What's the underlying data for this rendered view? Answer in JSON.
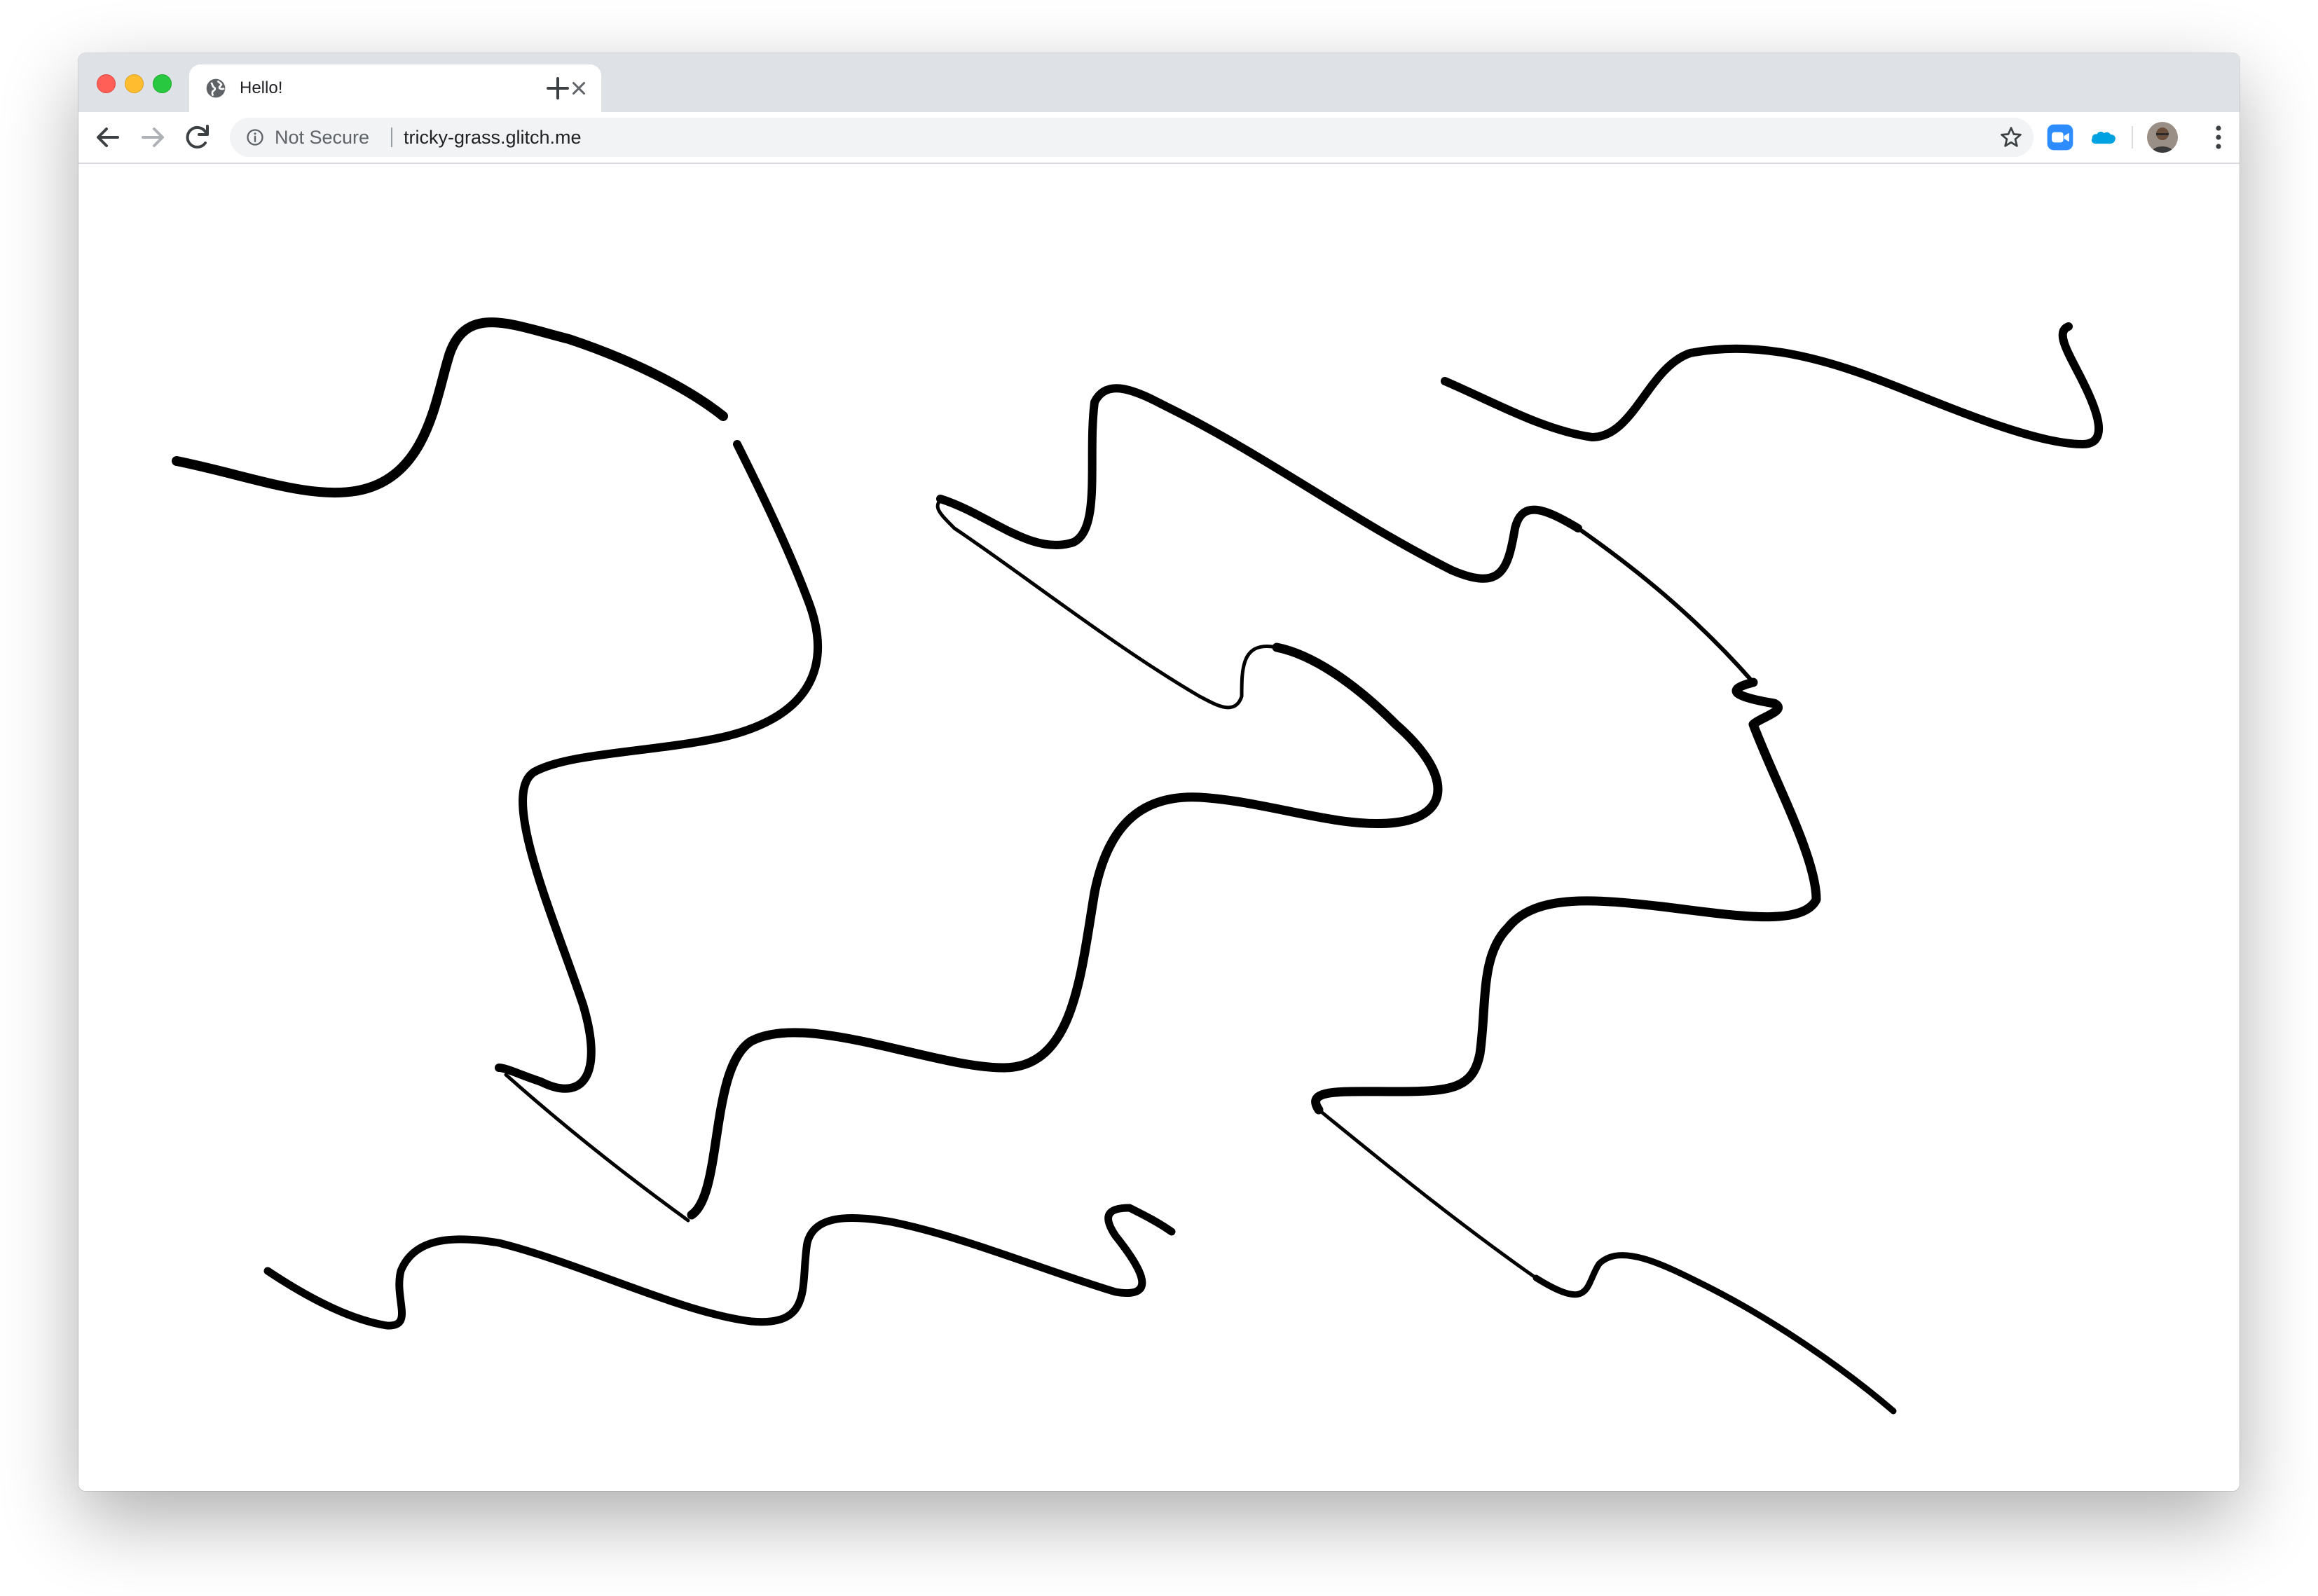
{
  "browser": {
    "tab": {
      "title": "Hello!",
      "favicon": "globe-icon",
      "close_icon": "close-icon"
    },
    "new_tab_icon": "plus-icon",
    "nav": {
      "back_icon": "arrow-left-icon",
      "forward_icon": "arrow-right-icon",
      "reload_icon": "reload-icon"
    },
    "omnibox": {
      "security_icon": "info-icon",
      "security_label": "Not Secure",
      "url": "tricky-grass.glitch.me",
      "bookmark_icon": "star-icon"
    },
    "extensions": [
      "zoom-icon",
      "salesforce-icon"
    ],
    "menu_icon": "kebab-menu-icon"
  },
  "page": {
    "content": "hand-drawn-black-ribbons",
    "ribbon_color": "#000000",
    "background_color": "#ffffff"
  },
  "colors": {
    "tabstrip": "#dee1e6",
    "omnibox": "#f1f3f4",
    "close": "#ff5f57",
    "minimize": "#febc2e",
    "zoom": "#28c840",
    "zoom_ext": "#2d8cff",
    "salesforce_ext": "#00a1e0"
  }
}
